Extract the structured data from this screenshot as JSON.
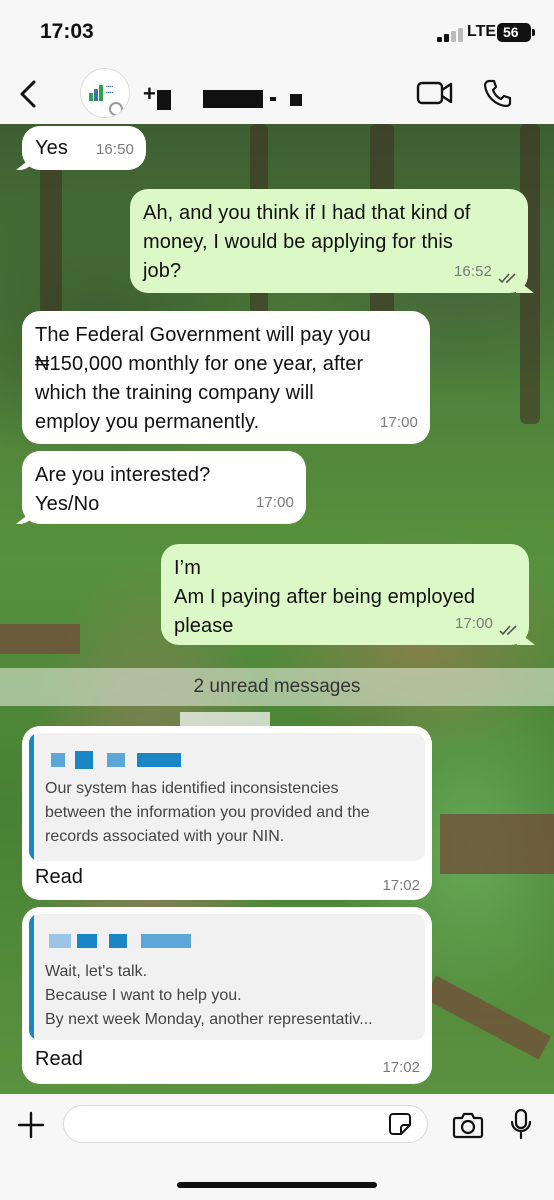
{
  "status": {
    "time": "17:03",
    "network": "LTE",
    "battery": "56"
  },
  "header": {
    "contact_name": "+",
    "avatar": "agency-logo"
  },
  "messages": [
    {
      "dir": "in",
      "text": "Yes",
      "time": "16:50"
    },
    {
      "dir": "out",
      "lines": [
        "Ah, and you think if I had that kind of",
        "money, I would be applying for this",
        "job?"
      ],
      "time": "16:52"
    },
    {
      "dir": "in",
      "lines": [
        "The Federal Government will pay you",
        "₦150,000 monthly for one year, after",
        "which the training company will",
        "employ you permanently."
      ],
      "time": "17:00"
    },
    {
      "dir": "in",
      "lines": [
        "Are you interested?",
        "Yes/No"
      ],
      "time": "17:00"
    },
    {
      "dir": "out",
      "lines": [
        "I’m",
        "Am I paying after being employed",
        "please"
      ],
      "time": "17:00"
    }
  ],
  "unread_label": "2 unread messages",
  "quoted": [
    {
      "lines": [
        "Our system has identified inconsistencies",
        "between the information you provided and the",
        "records associated with your NIN."
      ],
      "reply": "Read",
      "time": "17:02"
    },
    {
      "lines": [
        "Wait, let's talk.",
        "Because I want to help you.",
        "By next week Monday, another representativ..."
      ],
      "reply": "Read",
      "time": "17:02"
    }
  ],
  "input": {
    "placeholder": ""
  },
  "colors": {
    "outgoing": "#dcf8c6",
    "incoming": "#ffffff",
    "quote_bar": "#1a86c6"
  }
}
